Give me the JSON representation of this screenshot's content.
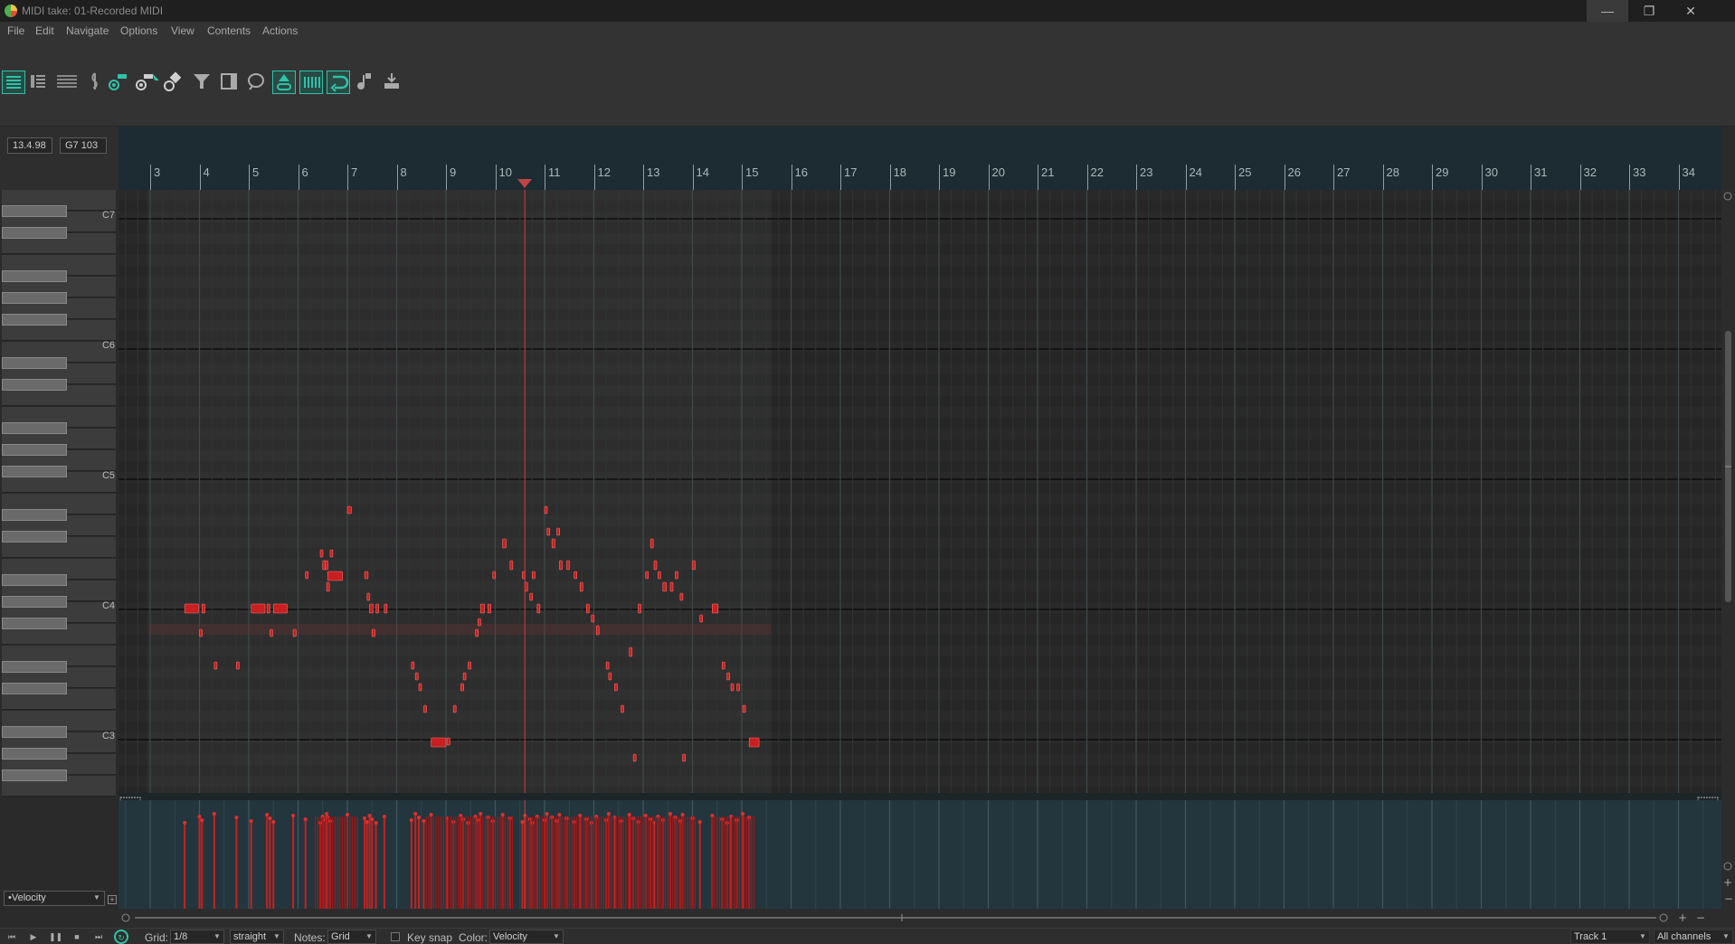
{
  "window": {
    "title": "MIDI take: 01-Recorded MIDI",
    "controls": {
      "minimize": "—",
      "maximize": "❐",
      "close": "✕"
    }
  },
  "menu": [
    "File",
    "Edit",
    "Navigate",
    "Options",
    "View",
    "Contents",
    "Actions"
  ],
  "toolbar": {
    "tools": [
      "piano-roll-view-icon",
      "named-notes-view-icon",
      "event-list-view-icon",
      "treble-clef-icon",
      "insert-note-icon",
      "erase-note-icon",
      "select-icon",
      "quantize-icon",
      "filter-icon",
      "dock-icon",
      "lasso-icon",
      "link-icon",
      "grid-icon",
      "loop-icon",
      "step-input-icon",
      "stretch-icon"
    ]
  },
  "info": {
    "position": "13.4.98",
    "note": "G7 103"
  },
  "ruler": {
    "measures": [
      "3",
      "4",
      "5",
      "6",
      "7",
      "8",
      "9",
      "10",
      "11",
      "12",
      "13",
      "14",
      "15",
      "16",
      "17",
      "18",
      "19",
      "20",
      "21",
      "22",
      "23",
      "24",
      "25",
      "26",
      "27",
      "28",
      "29",
      "30",
      "31",
      "32",
      "33",
      "34"
    ],
    "first_measure": 3
  },
  "piano": {
    "octave_labels": [
      "C7",
      "C6",
      "C5",
      "C4",
      "C3"
    ]
  },
  "notes_color": "#c82020",
  "cc_lane": {
    "selected_lane": "•Velocity"
  },
  "status": {
    "grid_label": "Grid:",
    "grid_value": "1/8",
    "swing_value": "straight",
    "notes_label": "Notes:",
    "notes_value": "Grid",
    "keysnap_label": "Key snap",
    "color_label": "Color:",
    "color_value": "Velocity",
    "track_value": "Track 1",
    "channels_value": "All channels"
  },
  "colors": {
    "accent": "#2fc2a8",
    "note": "#c82020",
    "playhead": "#d04040"
  }
}
